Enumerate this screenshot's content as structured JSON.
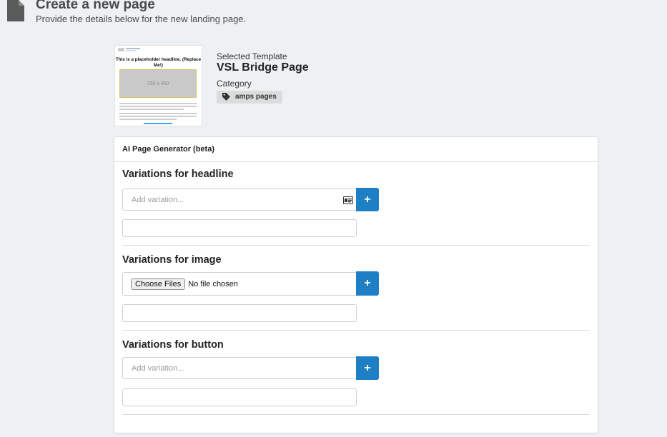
{
  "header": {
    "title": "Create a new page",
    "subtitle": "Provide the details below for the new landing page."
  },
  "template_preview": {
    "headline": "This is a placeholder headline. (Replace Me!)",
    "image_label": "720 x 450"
  },
  "template_info": {
    "selected_label": "Selected Template",
    "selected_name": "VSL Bridge Page",
    "category_label": "Category",
    "category_value": "amps pages"
  },
  "generator": {
    "title": "AI Page Generator (beta)",
    "headline": {
      "title": "Variations for headline",
      "placeholder": "Add variation...",
      "add_label": "+"
    },
    "image": {
      "title": "Variations for image",
      "choose_label": "Choose Files",
      "file_status": "No file chosen",
      "add_label": "+"
    },
    "button": {
      "title": "Variations for button",
      "placeholder": "Add variation...",
      "add_label": "+"
    }
  },
  "colors": {
    "accent": "#1f7fc4",
    "background": "#eef1f4"
  },
  "icons": {
    "page": "document-icon",
    "category": "tag-icon",
    "field": "id-card-icon"
  }
}
